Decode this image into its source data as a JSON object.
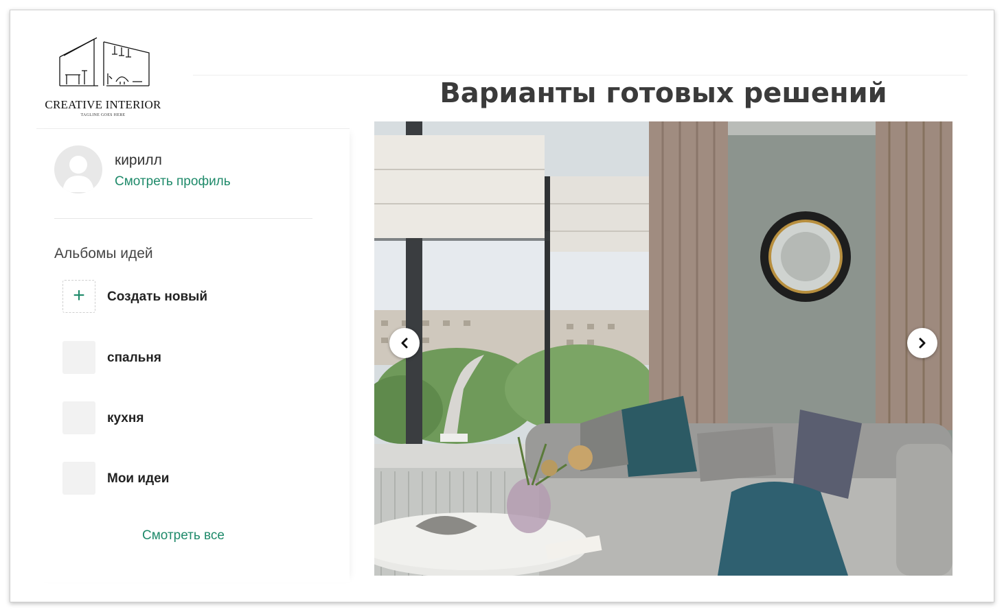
{
  "brand": {
    "name": "CREATIVE INTERIOR",
    "tagline": "TAGLINE GOES HERE"
  },
  "user": {
    "name": "кирилл",
    "profile_link": "Смотреть профиль"
  },
  "albums": {
    "title": "Альбомы идей",
    "create_label": "Создать новый",
    "items": [
      {
        "label": "спальня"
      },
      {
        "label": "кухня"
      },
      {
        "label": "Мои идеи"
      }
    ],
    "see_all": "Смотреть все"
  },
  "main": {
    "heading": "Варианты готовых решений"
  },
  "colors": {
    "accent": "#1f8a6a",
    "heading": "#3a3a3a"
  },
  "icons": {
    "create": "plus-icon",
    "prev": "chevron-left-icon",
    "next": "chevron-right-icon"
  }
}
